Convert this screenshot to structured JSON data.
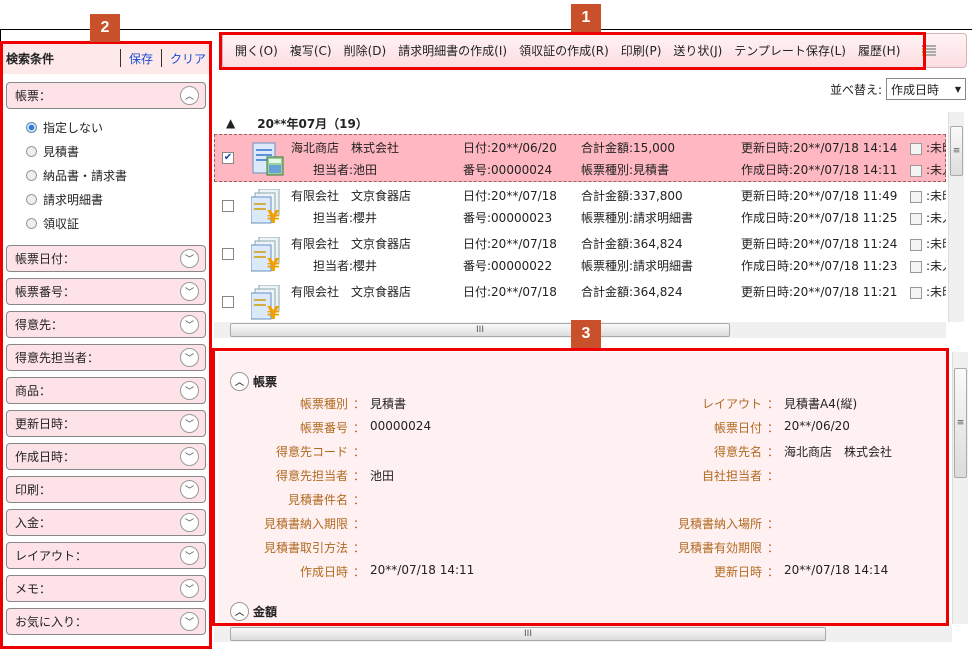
{
  "markers": [
    "1",
    "2",
    "3"
  ],
  "toolbar": {
    "buttons": [
      "開く(O)",
      "複写(C)",
      "削除(D)",
      "請求明細書の作成(I)",
      "領収証の作成(R)",
      "印刷(P)",
      "送り状(J)",
      "テンプレート保存(L)",
      "履歴(H)"
    ],
    "view_icon": "list-view-icon"
  },
  "sort": {
    "label": "並べ替え:",
    "selected": "作成日時"
  },
  "search": {
    "title": "検索条件",
    "save_link": "保存",
    "clear_link": "クリア",
    "doc_filter": {
      "label": "帳票：",
      "options": [
        "指定しない",
        "見積書",
        "納品書・請求書",
        "請求明細書",
        "領収証"
      ],
      "selected": "指定しない"
    },
    "filters": [
      "帳票日付：",
      "帳票番号：",
      "得意先：",
      "得意先担当者：",
      "商品：",
      "更新日時：",
      "作成日時：",
      "印刷：",
      "入金：",
      "レイアウト：",
      "メモ：",
      "お気に入り："
    ]
  },
  "list": {
    "group": "20**年07月（19）",
    "rows": [
      {
        "selected": true,
        "checked": true,
        "icon": "estimate-document-icon",
        "company": "海北商店　株式会社",
        "staff": "担当者:池田",
        "date": "日付:20**/06/20",
        "number": "番号:00000024",
        "total": "合計金額:15,000",
        "type": "帳票種別:見積書",
        "updated": "更新日時:20**/07/18 14:14",
        "created": "作成日時:20**/07/18 14:11",
        "flag1": ":未印",
        "flag2": ":未入"
      },
      {
        "selected": false,
        "checked": false,
        "icon": "invoice-detail-icon",
        "company": "有限会社　文京食器店",
        "staff": "担当者:櫻井",
        "date": "日付:20**/07/18",
        "number": "番号:00000023",
        "total": "合計金額:337,800",
        "type": "帳票種別:請求明細書",
        "updated": "更新日時:20**/07/18 11:49",
        "created": "作成日時:20**/07/18 11:25",
        "flag1": ":未印",
        "flag2": ":未入"
      },
      {
        "selected": false,
        "checked": false,
        "icon": "invoice-detail-icon",
        "company": "有限会社　文京食器店",
        "staff": "担当者:櫻井",
        "date": "日付:20**/07/18",
        "number": "番号:00000022",
        "total": "合計金額:364,824",
        "type": "帳票種別:請求明細書",
        "updated": "更新日時:20**/07/18 11:24",
        "created": "作成日時:20**/07/18 11:23",
        "flag1": ":未印",
        "flag2": ":未入"
      },
      {
        "selected": false,
        "checked": false,
        "icon": "invoice-detail-icon",
        "company": "有限会社　文京食器店",
        "staff": "",
        "date": "日付:20**/07/18",
        "number": "",
        "total": "合計金額:364,824",
        "type": "",
        "updated": "更新日時:20**/07/18 11:21",
        "created": "",
        "flag1": ":未印",
        "flag2": ""
      }
    ]
  },
  "detail": {
    "section1": "帳票",
    "section2": "金額",
    "left": [
      {
        "k": "帳票種別",
        "v": "見積書"
      },
      {
        "k": "帳票番号",
        "v": "00000024"
      },
      {
        "k": "得意先コード",
        "v": ""
      },
      {
        "k": "得意先担当者",
        "v": "池田"
      },
      {
        "k": "見積書件名",
        "v": ""
      },
      {
        "k": "見積書納入期限",
        "v": ""
      },
      {
        "k": "見積書取引方法",
        "v": ""
      },
      {
        "k": "作成日時",
        "v": "20**/07/18 14:11"
      }
    ],
    "right": [
      {
        "k": "レイアウト",
        "v": "見積書A4(縦)"
      },
      {
        "k": "帳票日付",
        "v": "20**/06/20"
      },
      {
        "k": "得意先名",
        "v": "海北商店　株式会社"
      },
      {
        "k": "自社担当者",
        "v": ""
      },
      {
        "k": "",
        "v": ""
      },
      {
        "k": "見積書納入場所",
        "v": ""
      },
      {
        "k": "見積書有効期限",
        "v": ""
      },
      {
        "k": "更新日時",
        "v": "20**/07/18 14:14"
      }
    ],
    "colon": "："
  }
}
